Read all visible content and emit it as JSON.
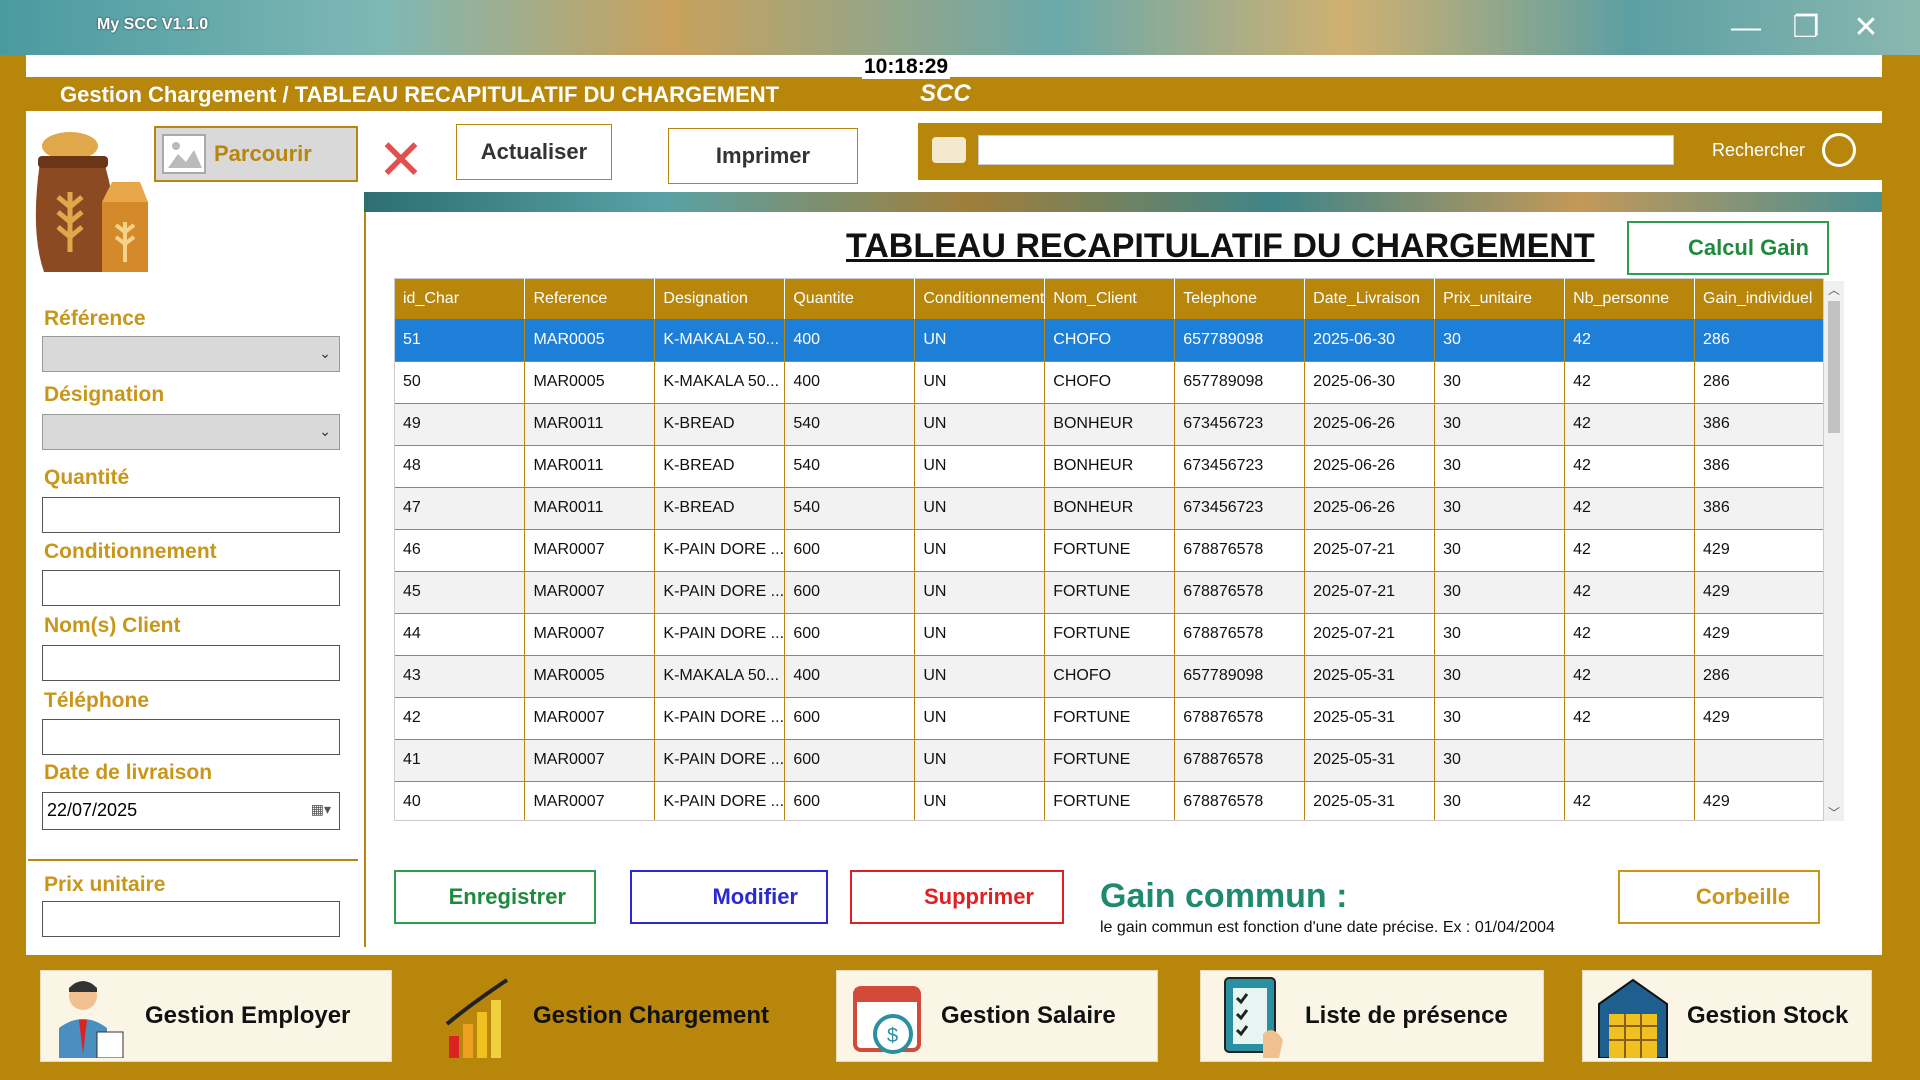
{
  "window": {
    "title": "My SCC  V1.1.0",
    "clock": "10:18:29"
  },
  "header": {
    "breadcrumb": "Gestion Chargement /  TABLEAU RECAPITULATIF DU CHARGEMENT",
    "logo": "SCC"
  },
  "toolbar": {
    "parcourir": "Parcourir",
    "actualiser": "Actualiser",
    "imprimer": "Imprimer",
    "search_label": "Rechercher",
    "search_value": ""
  },
  "form": {
    "reference_label": "Référence",
    "designation_label": "Désignation",
    "quantite_label": "Quantité",
    "conditionnement_label": "Conditionnement",
    "client_label": "Nom(s) Client",
    "telephone_label": "Téléphone",
    "date_label": "Date de livraison",
    "date_value": "22/07/2025",
    "prix_label": "Prix unitaire"
  },
  "table": {
    "title": "TABLEAU RECAPITULATIF DU CHARGEMENT",
    "calcul_gain": "Calcul Gain",
    "columns": [
      "id_Char",
      "Reference",
      "Designation",
      "Quantite",
      "Conditionnement",
      "Nom_Client",
      "Telephone",
      "Date_Livraison",
      "Prix_unitaire",
      "Nb_personne",
      "Gain_individuel"
    ],
    "rows": [
      [
        "51",
        "MAR0005",
        "K-MAKALA 50...",
        "400",
        "UN",
        "CHOFO",
        "657789098",
        "2025-06-30",
        "30",
        "42",
        "286"
      ],
      [
        "50",
        "MAR0005",
        "K-MAKALA 50...",
        "400",
        "UN",
        "CHOFO",
        "657789098",
        "2025-06-30",
        "30",
        "42",
        "286"
      ],
      [
        "49",
        "MAR0011",
        "K-BREAD",
        "540",
        "UN",
        "BONHEUR",
        "673456723",
        "2025-06-26",
        "30",
        "42",
        "386"
      ],
      [
        "48",
        "MAR0011",
        "K-BREAD",
        "540",
        "UN",
        "BONHEUR",
        "673456723",
        "2025-06-26",
        "30",
        "42",
        "386"
      ],
      [
        "47",
        "MAR0011",
        "K-BREAD",
        "540",
        "UN",
        "BONHEUR",
        "673456723",
        "2025-06-26",
        "30",
        "42",
        "386"
      ],
      [
        "46",
        "MAR0007",
        "K-PAIN DORE ...",
        "600",
        "UN",
        "FORTUNE",
        "678876578",
        "2025-07-21",
        "30",
        "42",
        "429"
      ],
      [
        "45",
        "MAR0007",
        "K-PAIN DORE ...",
        "600",
        "UN",
        "FORTUNE",
        "678876578",
        "2025-07-21",
        "30",
        "42",
        "429"
      ],
      [
        "44",
        "MAR0007",
        "K-PAIN DORE ...",
        "600",
        "UN",
        "FORTUNE",
        "678876578",
        "2025-07-21",
        "30",
        "42",
        "429"
      ],
      [
        "43",
        "MAR0005",
        "K-MAKALA 50...",
        "400",
        "UN",
        "CHOFO",
        "657789098",
        "2025-05-31",
        "30",
        "42",
        "286"
      ],
      [
        "42",
        "MAR0007",
        "K-PAIN DORE ...",
        "600",
        "UN",
        "FORTUNE",
        "678876578",
        "2025-05-31",
        "30",
        "42",
        "429"
      ],
      [
        "41",
        "MAR0007",
        "K-PAIN DORE ...",
        "600",
        "UN",
        "FORTUNE",
        "678876578",
        "2025-05-31",
        "30",
        "",
        ""
      ],
      [
        "40",
        "MAR0007",
        "K-PAIN DORE ...",
        "600",
        "UN",
        "FORTUNE",
        "678876578",
        "2025-05-31",
        "30",
        "42",
        "429"
      ]
    ],
    "selected_row": 0
  },
  "actions": {
    "enregistrer": "Enregistrer",
    "modifier": "Modifier",
    "supprimer": "Supprimer",
    "corbeille": "Corbeille",
    "gain_title": "Gain commun :",
    "gain_note": "le gain commun est fonction d'une date précise. Ex : 01/04/2004"
  },
  "nav": {
    "employer": "Gestion Employer",
    "chargement": "Gestion Chargement",
    "salaire": "Gestion Salaire",
    "presence": "Liste de présence",
    "stock": "Gestion Stock"
  },
  "colors": {
    "accent": "#b8860b",
    "selected": "#1e7fd8",
    "green": "#2e9e4e",
    "blue": "#2a2ad0",
    "red": "#e02020"
  }
}
